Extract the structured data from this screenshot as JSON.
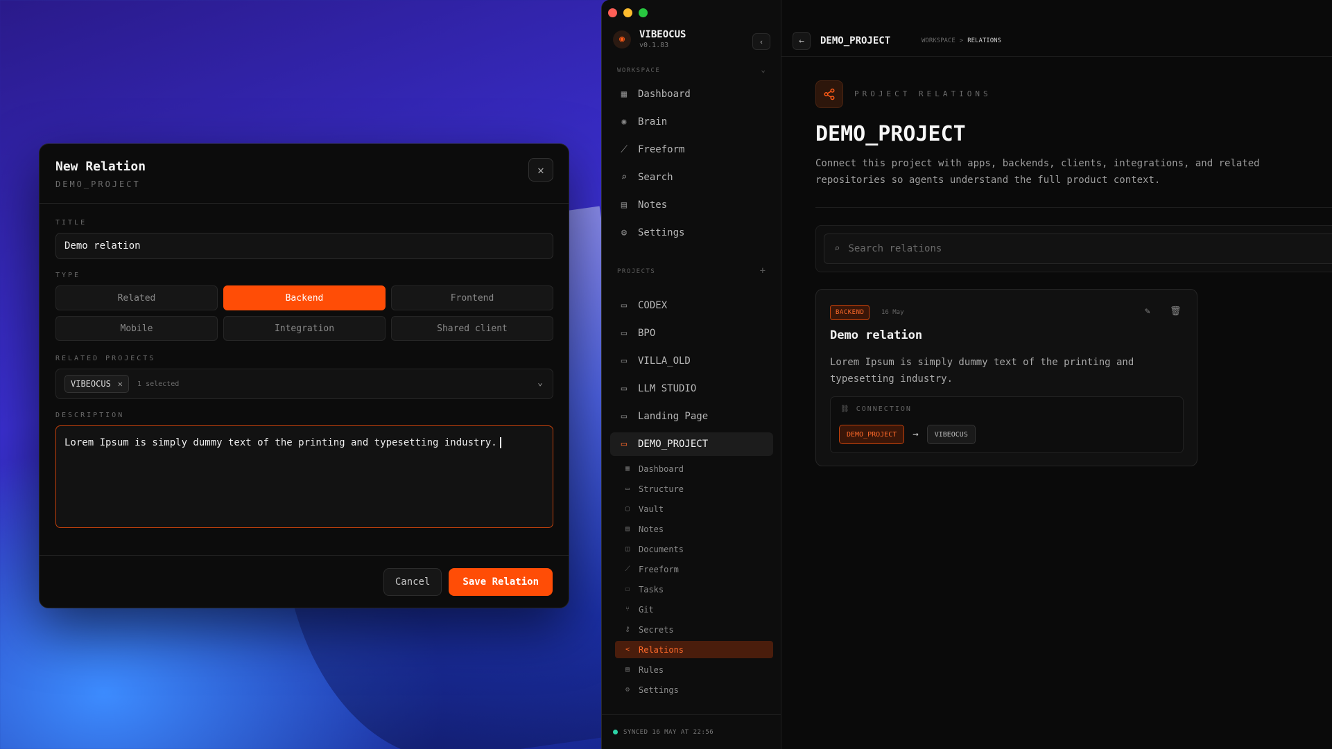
{
  "modal": {
    "title": "New Relation",
    "subtitle": "DEMO_PROJECT",
    "title_label": "TITLE",
    "title_value": "Demo relation",
    "type_label": "TYPE",
    "types": [
      "Related",
      "Backend",
      "Frontend",
      "Mobile",
      "Integration",
      "Shared client"
    ],
    "active_type": "Backend",
    "related_label": "RELATED PROJECTS",
    "related_chip": "VIBEOCUS",
    "related_count": "1 selected",
    "description_label": "DESCRIPTION",
    "description_value": "Lorem Ipsum is simply dummy text of the printing and typesetting industry.",
    "cancel_label": "Cancel",
    "save_label": "Save Relation"
  },
  "app": {
    "brand_name": "VIBEOCUS",
    "brand_version": "v0.1.83",
    "workspace_label": "WORKSPACE",
    "workspace_items": [
      "Dashboard",
      "Brain",
      "Freeform",
      "Search",
      "Notes",
      "Settings"
    ],
    "projects_label": "PROJECTS",
    "projects": [
      "CODEX",
      "BPO",
      "VILLA_OLD",
      "LLM STUDIO",
      "Landing Page",
      "DEMO_PROJECT"
    ],
    "active_project": "DEMO_PROJECT",
    "project_subitems": [
      "Dashboard",
      "Structure",
      "Vault",
      "Notes",
      "Documents",
      "Freeform",
      "Tasks",
      "Git",
      "Secrets",
      "Relations",
      "Rules",
      "Settings"
    ],
    "active_subitem": "Relations",
    "sync_status": "SYNCED 16 MAY AT 22:56"
  },
  "main": {
    "top_title": "DEMO_PROJECT",
    "breadcrumb": [
      "WORKSPACE",
      ">",
      "RELATIONS"
    ],
    "section_label": "PROJECT RELATIONS",
    "page_title": "DEMO_PROJECT",
    "page_description": "Connect this project with apps, backends, clients, integrations, and related repositories so agents understand the full product context.",
    "search_placeholder": "Search relations",
    "card": {
      "badge": "BACKEND",
      "date": "16 May",
      "title": "Demo relation",
      "description": "Lorem Ipsum is simply dummy text of the printing and typesetting industry.",
      "connection_label": "CONNECTION",
      "from": "DEMO_PROJECT",
      "to": "VIBEOCUS"
    }
  },
  "colors": {
    "accent": "#ff4d06",
    "accent_dark": "#3a1608",
    "sync_dot": "#2dd4a7",
    "traffic_red": "#ff5f57",
    "traffic_yellow": "#febc2e",
    "traffic_green": "#28c840"
  }
}
